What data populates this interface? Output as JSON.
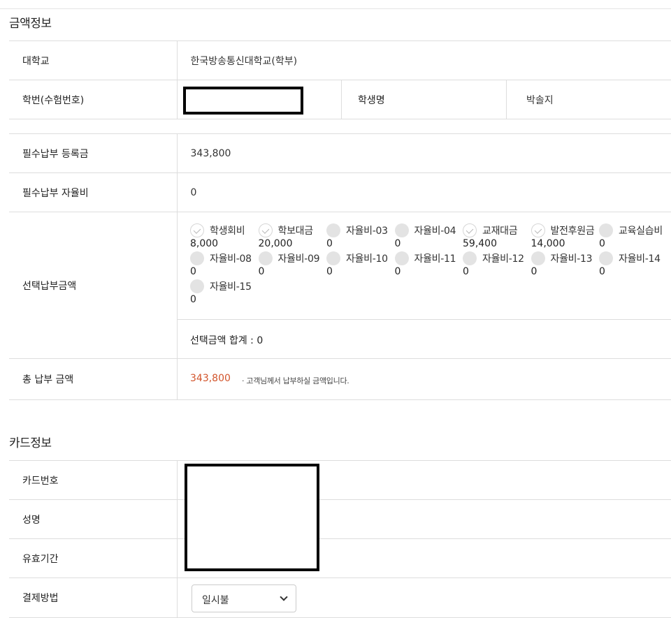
{
  "amount_section": {
    "title": "금액정보",
    "university_label": "대학교",
    "university_value": "한국방송통신대학교(학부)",
    "student_id_label": "학번(수험번호)",
    "student_name_label": "학생명",
    "student_name_value": "박솔지",
    "required_tuition_label": "필수납부 등록금",
    "required_tuition_value": "343,800",
    "required_fee_label": "필수납부 자율비",
    "required_fee_value": "0",
    "optional_label": "선택납부금액",
    "optional_items": [
      {
        "name": "학생회비",
        "amount": "8,000",
        "checked": true
      },
      {
        "name": "학보대금",
        "amount": "20,000",
        "checked": true
      },
      {
        "name": "자율비-03",
        "amount": "0",
        "checked": false
      },
      {
        "name": "자율비-04",
        "amount": "0",
        "checked": false
      },
      {
        "name": "교재대금",
        "amount": "59,400",
        "checked": true
      },
      {
        "name": "발전후원금",
        "amount": "14,000",
        "checked": true
      },
      {
        "name": "교육실습비",
        "amount": "0",
        "checked": false
      },
      {
        "name": "자율비-08",
        "amount": "0",
        "checked": false
      },
      {
        "name": "자율비-09",
        "amount": "0",
        "checked": false
      },
      {
        "name": "자율비-10",
        "amount": "0",
        "checked": false
      },
      {
        "name": "자율비-11",
        "amount": "0",
        "checked": false
      },
      {
        "name": "자율비-12",
        "amount": "0",
        "checked": false
      },
      {
        "name": "자율비-13",
        "amount": "0",
        "checked": false
      },
      {
        "name": "자율비-14",
        "amount": "0",
        "checked": false
      },
      {
        "name": "자율비-15",
        "amount": "0",
        "checked": false
      }
    ],
    "optional_sum_text": "선택금액 합계 : 0",
    "total_label": "총 납부 금액",
    "total_value": "343,800",
    "total_note": "· 고객님께서 납부하실 금액입니다."
  },
  "card_section": {
    "title": "카드정보",
    "card_number_label": "카드번호",
    "holder_name_label": "성명",
    "expiry_label": "유효기간",
    "payment_method_label": "결제방법",
    "payment_method_value": "일시불"
  }
}
